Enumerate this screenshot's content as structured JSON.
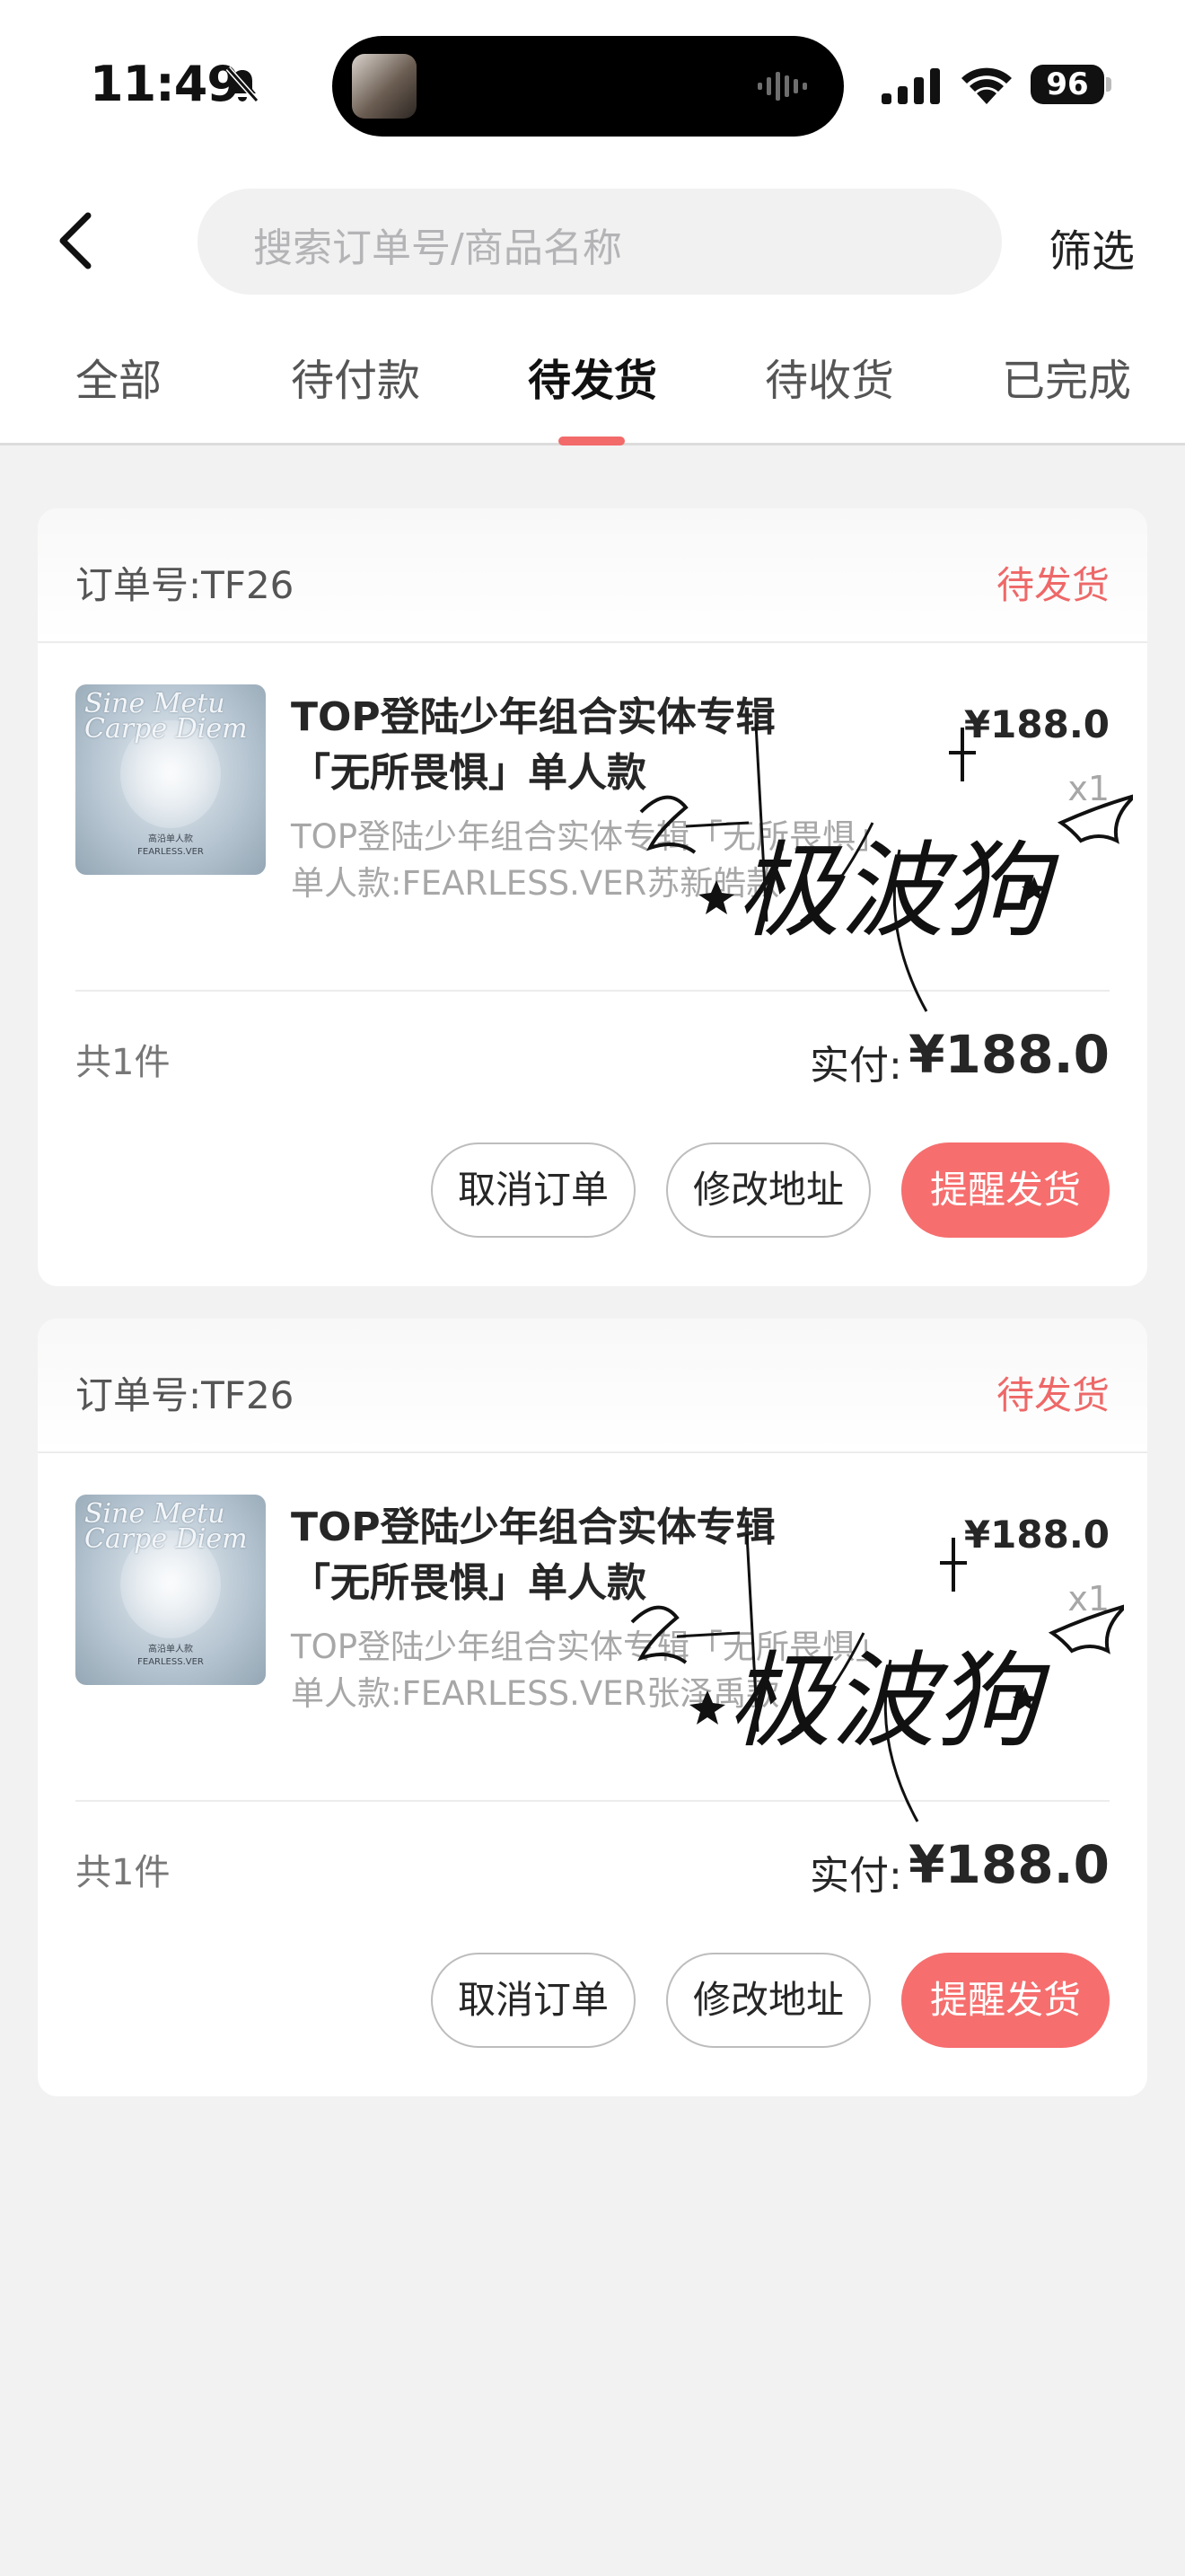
{
  "status_bar": {
    "time": "11:49",
    "battery": "96"
  },
  "header": {
    "search_placeholder": "搜索订单号/商品名称",
    "filter_label": "筛选"
  },
  "tabs": [
    {
      "label": "全部",
      "active": false
    },
    {
      "label": "待付款",
      "active": false
    },
    {
      "label": "待发货",
      "active": true
    },
    {
      "label": "待收货",
      "active": false
    },
    {
      "label": "已完成",
      "active": false
    }
  ],
  "orders": [
    {
      "order_no": "订单号:TF26",
      "status": "待发货",
      "product_title": "TOP登陆少年组合实体专辑「无所畏惧」单人款",
      "product_spec": "TOP登陆少年组合实体专辑「无所畏惧」单人款:FEARLESS.VER苏新皓款",
      "price": "¥188.0",
      "qty": "x1",
      "total_count": "共1件",
      "paid_label": "实付:",
      "paid_amount": "¥188.0",
      "buttons": {
        "cancel": "取消订单",
        "address": "修改地址",
        "remind": "提醒发货"
      }
    },
    {
      "order_no": "订单号:TF26",
      "status": "待发货",
      "product_title": "TOP登陆少年组合实体专辑「无所畏惧」单人款",
      "product_spec": "TOP登陆少年组合实体专辑「无所畏惧」单人款:FEARLESS.VER张泽禹款",
      "price": "¥188.0",
      "qty": "x1",
      "total_count": "共1件",
      "paid_label": "实付:",
      "paid_amount": "¥188.0",
      "buttons": {
        "cancel": "取消订单",
        "address": "修改地址",
        "remind": "提醒发货"
      }
    }
  ],
  "thumbnail": {
    "script_text": "Sine Metu Carpe Diem",
    "caption_line1": "高沿单人款",
    "caption_line2": "FEARLESS.VER"
  },
  "watermark_text": "极波狗",
  "colors": {
    "accent": "#f66e6e",
    "status_red": "#ee6868",
    "page_bg": "#f2f2f3"
  }
}
